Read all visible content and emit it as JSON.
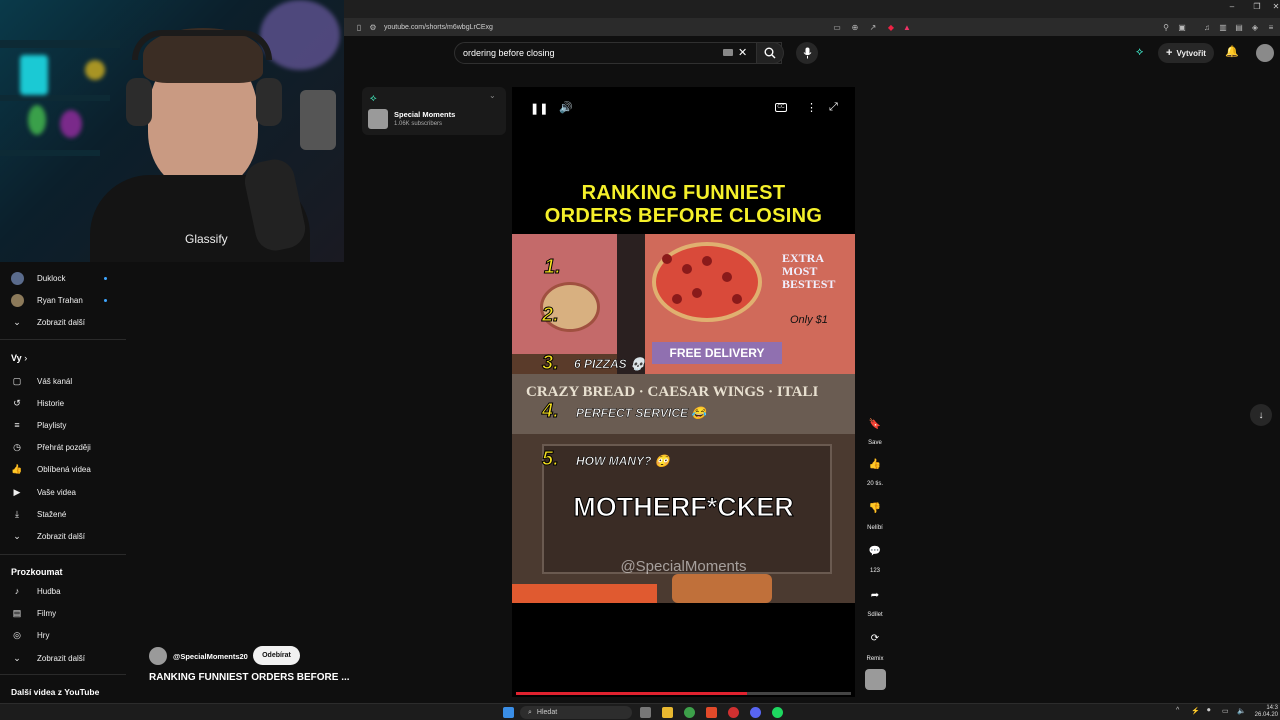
{
  "browser": {
    "url": "youtube.com/shorts/m6wbgLrCExg"
  },
  "webcam": {
    "shirt_text": "Glassify"
  },
  "header": {
    "search_value": "ordering before closing",
    "create_label": "Vytvořit"
  },
  "sidebar": {
    "subscriptions": [
      {
        "label": "Duklock",
        "avatar_color": "#5a6b8c"
      },
      {
        "label": "Ryan Trahan",
        "avatar_color": "#8c7a5a"
      }
    ],
    "show_more_1": "Zobrazit další",
    "you_heading": "Vy",
    "you_items": [
      {
        "label": "Váš kanál",
        "icon": "channel-icon"
      },
      {
        "label": "Historie",
        "icon": "history-icon"
      },
      {
        "label": "Playlisty",
        "icon": "playlists-icon"
      },
      {
        "label": "Přehrát později",
        "icon": "watch-later-icon"
      },
      {
        "label": "Oblíbená videa",
        "icon": "liked-videos-icon"
      },
      {
        "label": "Vaše videa",
        "icon": "your-videos-icon"
      },
      {
        "label": "Stažené",
        "icon": "downloads-icon"
      }
    ],
    "show_more_2": "Zobrazit další",
    "explore_heading": "Prozkoumat",
    "explore_items": [
      {
        "label": "Hudba",
        "icon": "music-icon"
      },
      {
        "label": "Filmy",
        "icon": "movies-icon"
      },
      {
        "label": "Hry",
        "icon": "gaming-icon"
      }
    ],
    "show_more_3": "Zobrazit další",
    "more_heading": "Další videa z YouTube"
  },
  "channel_card": {
    "name": "Special Moments",
    "subscribers": "1.06K subscribers"
  },
  "video": {
    "title_line1": "RANKING FUNNIEST",
    "title_line2": "ORDERS BEFORE CLOSING",
    "ranks": [
      {
        "num": "1.",
        "text": ""
      },
      {
        "num": "2.",
        "text": ""
      },
      {
        "num": "3.",
        "text": "6 PIZZAS 💀"
      },
      {
        "num": "4.",
        "text": "PERFECT SERVICE 😂"
      },
      {
        "num": "5.",
        "text": "HOW MANY? 😳"
      }
    ],
    "sign_text1": "EXTRA MOST BESTEST",
    "sign_text2": "Only $1",
    "delivery_text": "FREE DELIVERY",
    "menu_text": "CRAZY BREAD · CAESAR WINGS · ITALI",
    "caption": "MOTHERF*CKER",
    "watermark": "@SpecialMoments",
    "progress": 0.69
  },
  "actions": [
    {
      "label": "Save",
      "icon": "save-icon"
    },
    {
      "label": "20 tis.",
      "icon": "like-icon"
    },
    {
      "label": "Nelíbí",
      "icon": "dislike-icon"
    },
    {
      "label": "123",
      "icon": "comment-icon"
    },
    {
      "label": "Sdílet",
      "icon": "share-icon"
    },
    {
      "label": "Remix",
      "icon": "remix-icon"
    }
  ],
  "meta": {
    "handle": "@SpecialMoments20",
    "subscribe_label": "Odebírat",
    "video_title": "RANKING FUNNIEST ORDERS BEFORE ..."
  },
  "taskbar": {
    "search_label": "Hledat",
    "time": "14:3",
    "date": "26.04.20"
  }
}
